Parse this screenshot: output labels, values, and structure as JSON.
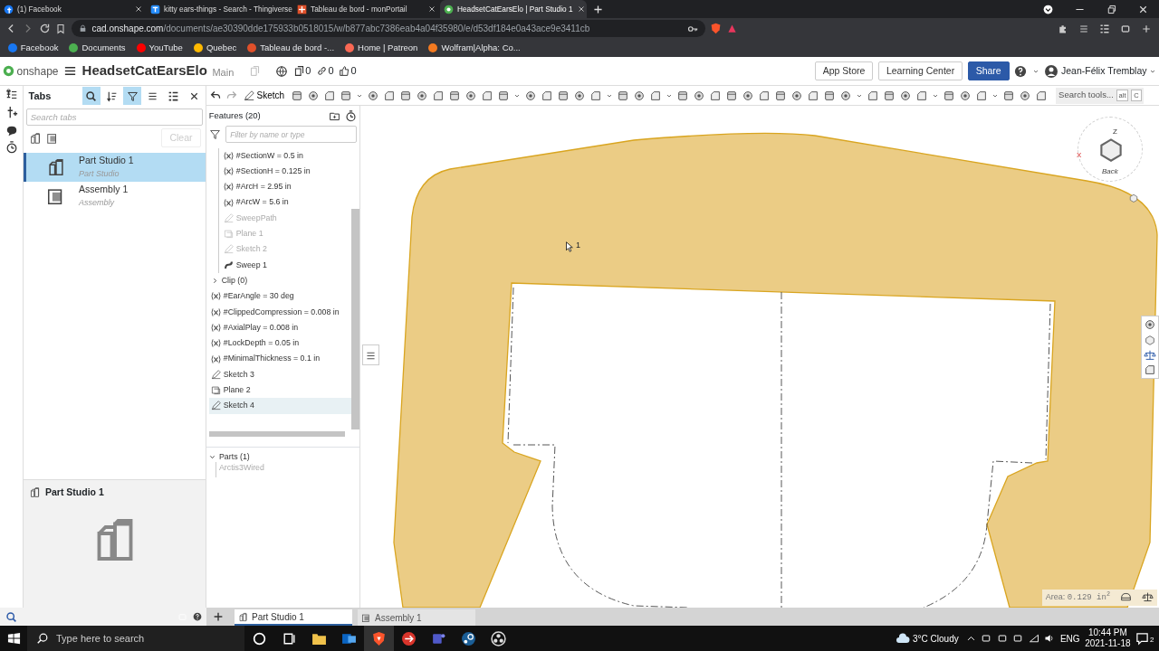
{
  "browser": {
    "tabs": [
      {
        "title": "(1) Facebook",
        "selected": false
      },
      {
        "title": "kitty ears-things - Search - Thingiverse",
        "selected": false
      },
      {
        "title": "Tableau de bord - monPortail",
        "selected": false
      },
      {
        "title": "HeadsetCatEarsElo | Part Studio 1",
        "selected": true
      }
    ],
    "address": {
      "host": "cad.onshape.com",
      "path": "/documents/ae30390dde175933b0518015/w/b877abc7386eab4a04f35980/e/d53df184e0a43ace9e3411cb"
    },
    "bookmarks": [
      {
        "label": "Facebook",
        "color": "#1877f2"
      },
      {
        "label": "Documents",
        "color": "#4caf50"
      },
      {
        "label": "YouTube",
        "color": "#ff0000"
      },
      {
        "label": "Quebec",
        "color": "#ffb900"
      },
      {
        "label": "Tableau de bord -...",
        "color": "#e0502a"
      },
      {
        "label": "Home | Patreon",
        "color": "#f96854"
      },
      {
        "label": "Wolfram|Alpha: Co...",
        "color": "#f47a20"
      }
    ]
  },
  "header": {
    "logo": "onshape",
    "document": "HeadsetCatEarsElo",
    "branch": "Main",
    "versions": "0",
    "links": "0",
    "likes": "0",
    "buttons": [
      {
        "label": "App Store",
        "kind": "outline"
      },
      {
        "label": "Learning Center",
        "kind": "outline"
      },
      {
        "label": "Share",
        "kind": "primary"
      }
    ],
    "user": "Jean-Félix Tremblay"
  },
  "tabs_panel": {
    "title": "Tabs",
    "tools": [
      {
        "kind": "search",
        "active": true
      },
      {
        "kind": "sort",
        "active": false
      },
      {
        "kind": "filter",
        "active": true
      },
      {
        "kind": "list",
        "active": false
      },
      {
        "kind": "detail",
        "active": false
      },
      {
        "kind": "close",
        "active": false
      }
    ],
    "search_placeholder": "Search tabs",
    "clear": {
      "label": "Clear",
      "disabled": true
    },
    "items": [
      {
        "name": "Part Studio 1",
        "type": "Part Studio",
        "kind": "part-studio",
        "selected": true
      },
      {
        "name": "Assembly 1",
        "type": "Assembly",
        "kind": "assembly",
        "selected": false
      }
    ],
    "preview_title": "Part Studio 1"
  },
  "toolbar": {
    "sketch_label": "Sketch",
    "search_placeholder": "Search tools...",
    "shortcut_keys": [
      "alt",
      "C"
    ]
  },
  "features": {
    "title": "Features (20)",
    "filter_placeholder": "Filter by name or type",
    "items": [
      {
        "kind": "group",
        "children": [
          {
            "kind": "variable",
            "label": "#SectionW = 0.5 in",
            "dimmed": false,
            "selected": false
          },
          {
            "kind": "variable",
            "label": "#SectionH = 0.125 in",
            "dimmed": false,
            "selected": false
          },
          {
            "kind": "variable",
            "label": "#ArcH = 2.95 in",
            "dimmed": false,
            "selected": false
          },
          {
            "kind": "variable",
            "label": "#ArcW = 5.6 in",
            "dimmed": false,
            "selected": false
          },
          {
            "kind": "sketch",
            "label": "SweepPath",
            "dimmed": true,
            "selected": false
          },
          {
            "kind": "plane",
            "label": "Plane 1",
            "dimmed": true,
            "selected": false
          },
          {
            "kind": "sketch",
            "label": "Sketch 2",
            "dimmed": true,
            "selected": false
          },
          {
            "kind": "sweep",
            "label": "Sweep 1",
            "dimmed": false,
            "selected": false
          }
        ]
      },
      {
        "kind": "folder",
        "label": "Clip (0)",
        "expanded": false,
        "dimmed": false,
        "selected": false
      },
      {
        "kind": "variable",
        "label": "#EarAngle = 30 deg",
        "dimmed": false,
        "selected": false
      },
      {
        "kind": "variable",
        "label": "#ClippedCompression = 0.008 in",
        "dimmed": false,
        "selected": false
      },
      {
        "kind": "variable",
        "label": "#AxialPlay = 0.008 in",
        "dimmed": false,
        "selected": false
      },
      {
        "kind": "variable",
        "label": "#LockDepth = 0.05 in",
        "dimmed": false,
        "selected": false
      },
      {
        "kind": "variable",
        "label": "#MinimalThickness = 0.1 in",
        "dimmed": false,
        "selected": false
      },
      {
        "kind": "sketch",
        "label": "Sketch 3",
        "dimmed": false,
        "selected": false
      },
      {
        "kind": "plane",
        "label": "Plane 2",
        "dimmed": false,
        "selected": false
      },
      {
        "kind": "sketch",
        "label": "Sketch 4",
        "dimmed": false,
        "selected": true
      }
    ]
  },
  "parts": {
    "title": "Parts (1)",
    "expanded": true,
    "items": [
      {
        "label": "Arctis3Wired",
        "dimmed": true
      }
    ]
  },
  "canvas": {
    "cursor_label": "1",
    "view_cube": {
      "z": "Z",
      "x": "X",
      "face": "Back"
    },
    "area_label": "Area:",
    "area_value": "0.129 in$^{2}$"
  },
  "bottom_tabs": [
    {
      "label": "Part Studio 1",
      "kind": "part-studio",
      "selected": true
    },
    {
      "label": "Assembly 1",
      "kind": "assembly",
      "selected": false
    }
  ],
  "taskbar": {
    "search_placeholder": "Type here to search",
    "weather": "3°C  Cloudy",
    "language": "ENG",
    "time": "10:44 PM",
    "date": "2021-11-18",
    "notifications": "2"
  }
}
